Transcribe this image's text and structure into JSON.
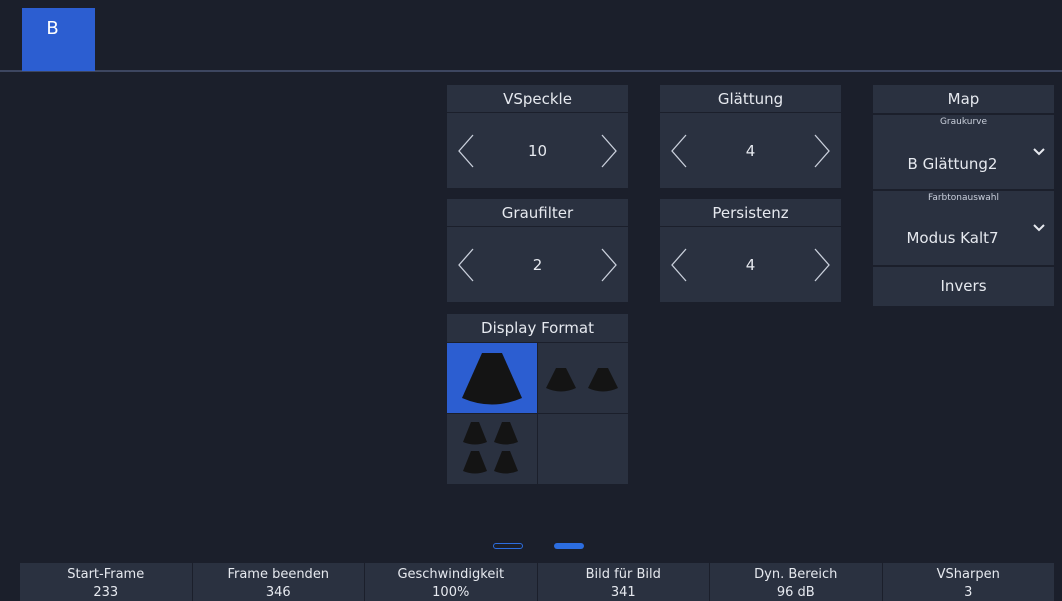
{
  "tab": {
    "label": "B"
  },
  "steppers": {
    "vspeckle": {
      "title": "VSpeckle",
      "value": "10"
    },
    "glaettung": {
      "title": "Glättung",
      "value": "4"
    },
    "graufilter": {
      "title": "Graufilter",
      "value": "2"
    },
    "persistenz": {
      "title": "Persistenz",
      "value": "4"
    }
  },
  "map": {
    "title": "Map",
    "graukurve": {
      "label": "Graukurve",
      "value": "B Glättung2"
    },
    "farbton": {
      "label": "Farbtonauswahl",
      "value": "Modus Kalt7"
    },
    "invers_label": "Invers"
  },
  "display_format": {
    "title": "Display Format",
    "options": [
      "single",
      "dual",
      "quad",
      "empty"
    ],
    "selected": "single"
  },
  "pagination": {
    "pages": 2,
    "current": 2
  },
  "bottom_bar": [
    {
      "label": "Start-Frame",
      "value": "233"
    },
    {
      "label": "Frame beenden",
      "value": "346"
    },
    {
      "label": "Geschwindigkeit",
      "value": "100%"
    },
    {
      "label": "Bild für Bild",
      "value": "341"
    },
    {
      "label": "Dyn. Bereich",
      "value": "96 dB"
    },
    {
      "label": "VSharpen",
      "value": "3"
    }
  ],
  "colors": {
    "background": "#1b1f2b",
    "panel": "#2a3140",
    "accent": "#2c5ed1"
  }
}
